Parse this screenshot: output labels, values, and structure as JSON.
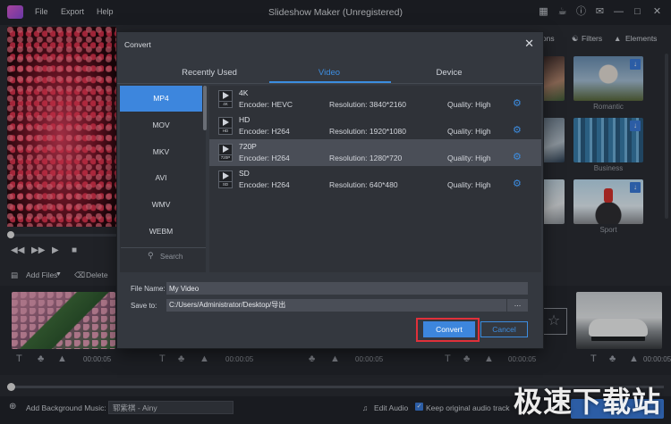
{
  "window": {
    "title": "Slideshow Maker (Unregistered)",
    "menu": [
      "File",
      "Export",
      "Help"
    ]
  },
  "right_panel": {
    "tabs": [
      "ions",
      "Filters",
      "Elements"
    ],
    "thumbnails": [
      {
        "label": "Romantic"
      },
      {
        "label": "Business"
      },
      {
        "label": "Sport"
      }
    ]
  },
  "toolbar": {
    "add_files": "Add Files",
    "delete": "Delete"
  },
  "timeline": {
    "durations": [
      "00:00:05",
      "00:00:05",
      "00:00:05",
      "00:00:05",
      "00:00:05"
    ]
  },
  "bottom_bar": {
    "add_bg_music": "Add Background Music:",
    "bg_music_value": "郓紫棋 - Ainy",
    "edit_audio": "Edit Audio",
    "keep_original": "Keep original audio track"
  },
  "dialog": {
    "title": "Convert",
    "tabs": [
      "Recently Used",
      "Video",
      "Device"
    ],
    "active_tab": "Video",
    "formats": [
      "MP4",
      "MOV",
      "MKV",
      "AVI",
      "WMV",
      "WEBM"
    ],
    "active_format": "MP4",
    "search_placeholder": "Search",
    "resolutions": [
      {
        "name": "4K",
        "tag": "4K",
        "encoder": "Encoder: HEVC",
        "resolution": "Resolution: 3840*2160",
        "quality": "Quality: High"
      },
      {
        "name": "HD",
        "tag": "HD",
        "encoder": "Encoder: H264",
        "resolution": "Resolution: 1920*1080",
        "quality": "Quality: High"
      },
      {
        "name": "720P",
        "tag": "720P",
        "encoder": "Encoder: H264",
        "resolution": "Resolution: 1280*720",
        "quality": "Quality: High"
      },
      {
        "name": "SD",
        "tag": "SD",
        "encoder": "Encoder: H264",
        "resolution": "Resolution: 640*480",
        "quality": "Quality: High"
      }
    ],
    "file_name_label": "File Name:",
    "file_name_value": "My Video",
    "save_to_label": "Save to:",
    "save_to_value": "C:/Users/Administrator/Desktop/导出",
    "browse_label": "…",
    "convert_label": "Convert",
    "cancel_label": "Cancel"
  },
  "watermark": "极速下载站",
  "colors": {
    "accent": "#3d86dd",
    "highlight": "#e0303a"
  }
}
